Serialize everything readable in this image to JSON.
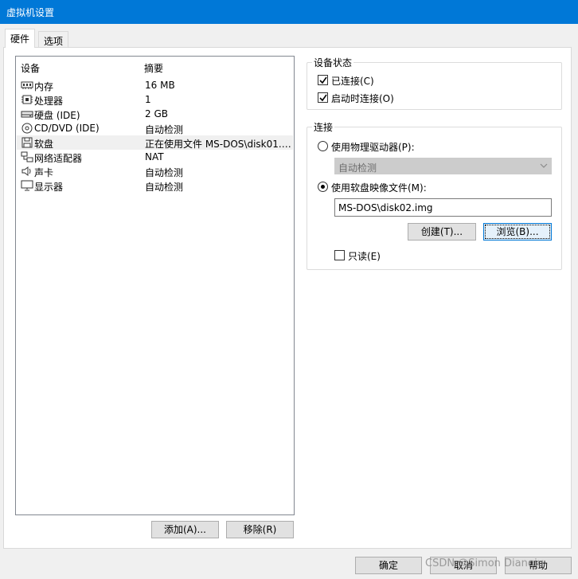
{
  "window": {
    "title": "虚拟机设置"
  },
  "tabs": [
    {
      "label": "硬件"
    },
    {
      "label": "选项"
    }
  ],
  "device_list": {
    "columns": {
      "device": "设备",
      "summary": "摘要"
    },
    "rows": [
      {
        "name": "内存",
        "summary": "16 MB",
        "icon": "memory-icon"
      },
      {
        "name": "处理器",
        "summary": "1",
        "icon": "processor-icon"
      },
      {
        "name": "硬盘 (IDE)",
        "summary": "2 GB",
        "icon": "hard-disk-icon"
      },
      {
        "name": "CD/DVD (IDE)",
        "summary": "自动检测",
        "icon": "cd-dvd-icon"
      },
      {
        "name": "软盘",
        "summary": "正在使用文件 MS-DOS\\disk01.i...",
        "icon": "floppy-icon"
      },
      {
        "name": "网络适配器",
        "summary": "NAT",
        "icon": "network-adapter-icon"
      },
      {
        "name": "声卡",
        "summary": "自动检测",
        "icon": "sound-card-icon"
      },
      {
        "name": "显示器",
        "summary": "自动检测",
        "icon": "display-icon"
      }
    ],
    "add_label": "添加(A)...",
    "remove_label": "移除(R)"
  },
  "device_status": {
    "title": "设备状态",
    "connected_label": "已连接(C)",
    "connected": true,
    "connect_on_power_label": "启动时连接(O)",
    "connect_on_power": true
  },
  "connection": {
    "title": "连接",
    "physical_label": "使用物理驱动器(P):",
    "physical_selected": false,
    "physical_value": "自动检测",
    "image_label": "使用软盘映像文件(M):",
    "image_selected": true,
    "image_path": "MS-DOS\\disk02.img",
    "create_label": "创建(T)...",
    "browse_label": "浏览(B)...",
    "readonly_label": "只读(E)",
    "readonly": false
  },
  "footer": {
    "ok_label": "确定",
    "cancel_label": "取消",
    "help_label": "帮助"
  },
  "watermark": "CSDN @Simon Dianqiu",
  "colors": {
    "titlebar": "#0078d7",
    "focus": "#0078d7",
    "selected_row": "#f0f0f0"
  }
}
